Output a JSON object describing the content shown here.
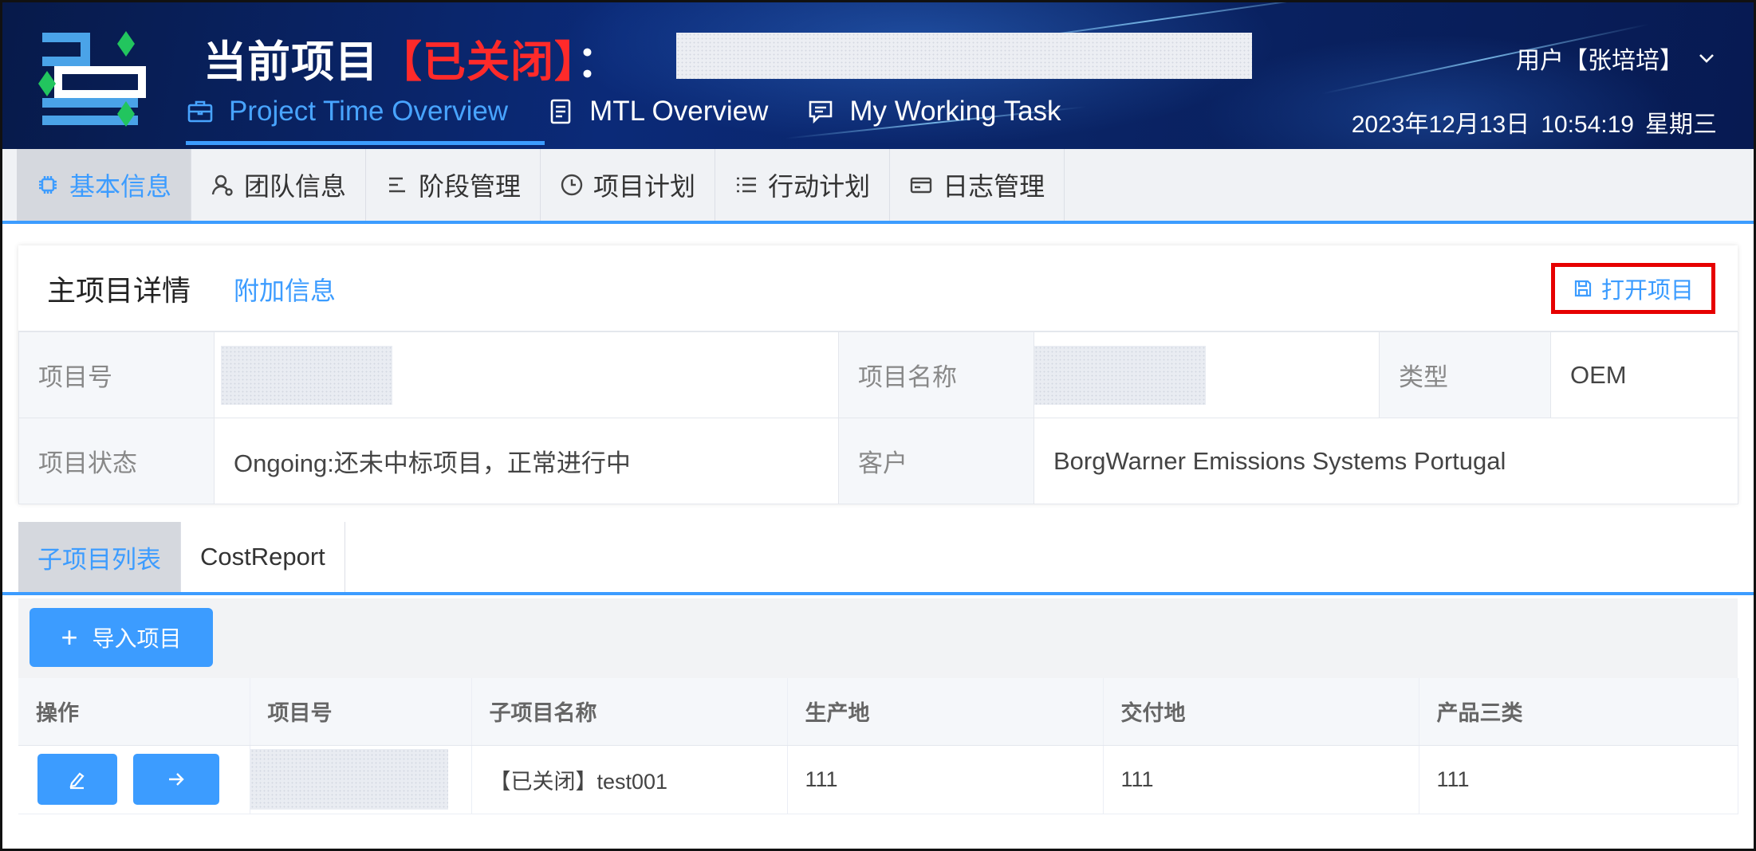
{
  "header": {
    "title_prefix": "当前项目",
    "title_status": "【已关闭】",
    "title_colon": "：",
    "nav": [
      {
        "label": "Project Time Overview",
        "icon": "briefcase-icon",
        "active": true
      },
      {
        "label": "MTL Overview",
        "icon": "document-icon",
        "active": false
      },
      {
        "label": "My Working Task",
        "icon": "message-icon",
        "active": false
      }
    ],
    "user_label": "用户【张培培】",
    "date": "2023年12月13日",
    "time": "10:54:19",
    "weekday": "星期三"
  },
  "subtabs": [
    {
      "label": "基本信息",
      "icon": "cpu-icon",
      "active": true
    },
    {
      "label": "团队信息",
      "icon": "user-icon",
      "active": false
    },
    {
      "label": "阶段管理",
      "icon": "stages-icon",
      "active": false
    },
    {
      "label": "项目计划",
      "icon": "clock-icon",
      "active": false
    },
    {
      "label": "行动计划",
      "icon": "list-icon",
      "active": false
    },
    {
      "label": "日志管理",
      "icon": "card-icon",
      "active": false
    }
  ],
  "detail": {
    "title": "主项目详情",
    "extra_link": "附加信息",
    "open_button": "打开项目",
    "labels": {
      "project_no": "项目号",
      "project_name": "项目名称",
      "type": "类型",
      "status": "项目状态",
      "customer": "客户"
    },
    "values": {
      "type": "OEM",
      "status": "Ongoing:还未中标项目，正常进行中",
      "customer": "BorgWarner Emissions Systems Portugal"
    }
  },
  "bottom_tabs": [
    {
      "label": "子项目列表",
      "active": true
    },
    {
      "label": "CostReport",
      "active": false
    }
  ],
  "toolbar": {
    "import_label": "导入项目"
  },
  "subproject_table": {
    "columns": [
      "操作",
      "项目号",
      "子项目名称",
      "生产地",
      "交付地",
      "产品三类"
    ],
    "rows": [
      {
        "name": "【已关闭】test001",
        "production_site": "111",
        "delivery_site": "111",
        "product_category": "111"
      }
    ]
  },
  "colors": {
    "accent": "#3c9cff",
    "closed_red": "#ff2a2a",
    "highlight_border": "#e60000",
    "header_bg": "#0b2a78"
  }
}
